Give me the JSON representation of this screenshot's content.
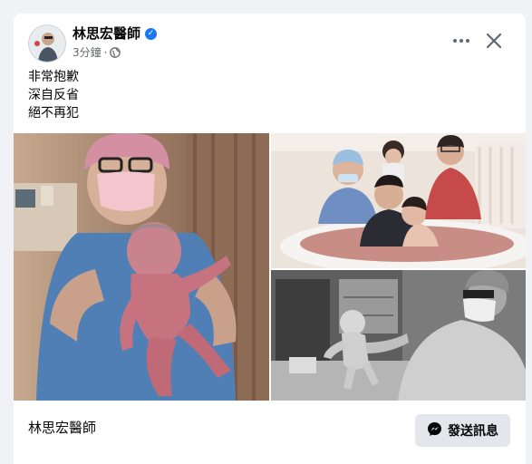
{
  "post": {
    "author": "林思宏醫師",
    "time": "3分鐘",
    "separator": "·",
    "lines": [
      "非常抱歉",
      "深自反省",
      "絕不再犯"
    ]
  },
  "footer": {
    "page_name": "林思宏醫師",
    "send_label": "發送訊息"
  },
  "icons": {
    "verified": "verified-badge-icon",
    "privacy": "globe-icon",
    "more": "more-options-icon",
    "close": "close-icon",
    "messenger": "messenger-icon"
  },
  "colors": {
    "accent": "#1877f2",
    "secondary_text": "#65676b",
    "button_bg": "#e4e6eb",
    "page_bg": "#f0f2f5"
  }
}
